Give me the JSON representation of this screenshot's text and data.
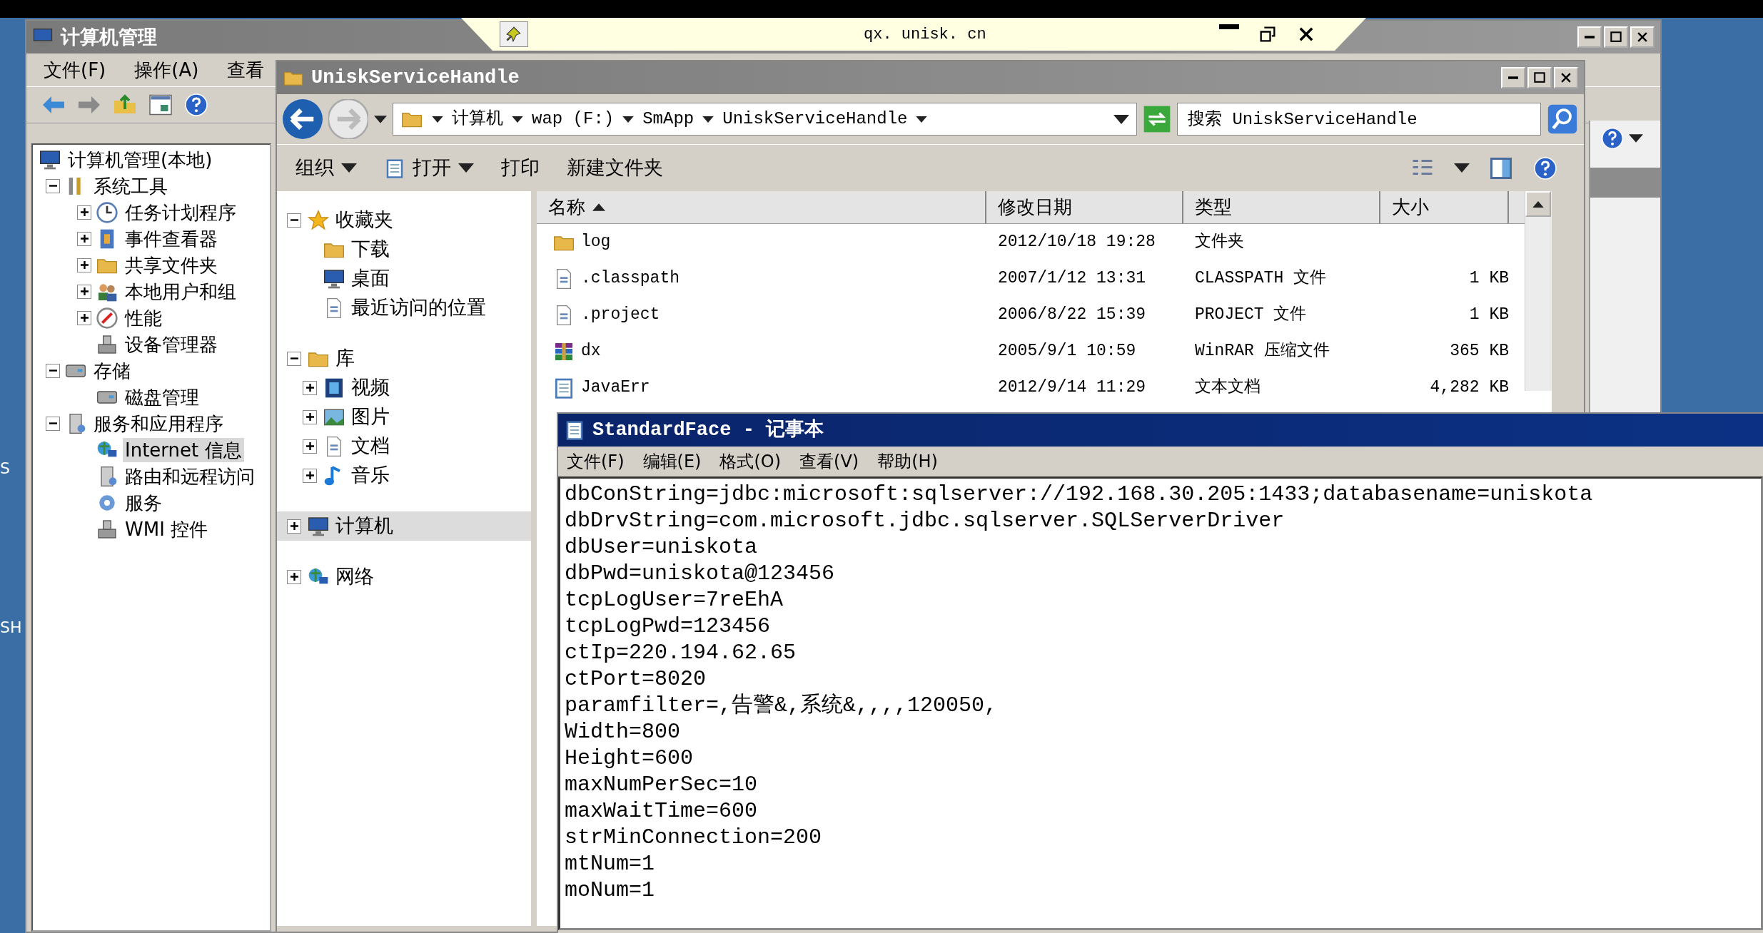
{
  "desktop_labels": [
    "S",
    "SH"
  ],
  "remote_bar": {
    "host": "qx. unisk. cn"
  },
  "mmc": {
    "title": "计算机管理",
    "menu": [
      "文件(F)",
      "操作(A)",
      "查看"
    ],
    "tree": [
      {
        "label": "计算机管理(本地)",
        "selected": false,
        "children": [
          {
            "label": "系统工具",
            "expanded": true,
            "selected": false,
            "children": [
              {
                "label": "任务计划程序",
                "expanded": false,
                "selected": false
              },
              {
                "label": "事件查看器",
                "expanded": false,
                "selected": false
              },
              {
                "label": "共享文件夹",
                "expanded": false,
                "selected": false
              },
              {
                "label": "本地用户和组",
                "expanded": false,
                "selected": false
              },
              {
                "label": "性能",
                "expanded": false,
                "selected": false
              },
              {
                "label": "设备管理器",
                "selected": false
              }
            ]
          },
          {
            "label": "存储",
            "expanded": true,
            "selected": false,
            "children": [
              {
                "label": "磁盘管理",
                "selected": false
              }
            ]
          },
          {
            "label": "服务和应用程序",
            "expanded": true,
            "selected": false,
            "children": [
              {
                "label": "Internet 信息",
                "selected": true
              },
              {
                "label": "路由和远程访问",
                "selected": false
              },
              {
                "label": "服务",
                "selected": false
              },
              {
                "label": "WMI 控件",
                "selected": false
              }
            ]
          }
        ]
      }
    ]
  },
  "explorer": {
    "title": "UniskServiceHandle",
    "breadcrumbs": [
      "计算机",
      "wap (F:)",
      "SmApp",
      "UniskServiceHandle"
    ],
    "search": {
      "placeholder": "搜索 UniskServiceHandle"
    },
    "commands": [
      {
        "label": "组织",
        "dropdown": true
      },
      {
        "label": "打开",
        "dropdown": true
      },
      {
        "label": "打印",
        "dropdown": false
      },
      {
        "label": "新建文件夹",
        "dropdown": false
      }
    ],
    "nav": [
      {
        "label": "收藏夹",
        "expanded": true,
        "selected": false,
        "children": [
          {
            "label": "下载"
          },
          {
            "label": "桌面"
          },
          {
            "label": "最近访问的位置"
          }
        ]
      },
      {
        "label": "库",
        "expanded": true,
        "selected": false,
        "children": [
          {
            "label": "视频",
            "expanded": false
          },
          {
            "label": "图片",
            "expanded": false
          },
          {
            "label": "文档",
            "expanded": false
          },
          {
            "label": "音乐",
            "expanded": false
          }
        ]
      },
      {
        "label": "计算机",
        "expanded": false,
        "selected": true
      },
      {
        "label": "网络",
        "expanded": false,
        "selected": false
      }
    ],
    "columns": [
      {
        "label": "名称",
        "sorted": true
      },
      {
        "label": "修改日期",
        "sorted": false
      },
      {
        "label": "类型",
        "sorted": false
      },
      {
        "label": "大小",
        "sorted": false
      }
    ],
    "files": [
      {
        "kind": "folder",
        "name": "log",
        "modified": "2012/10/18 19:28",
        "type": "文件夹"
      },
      {
        "kind": "file",
        "name": ".classpath",
        "modified": "2007/1/12 13:31",
        "type": "CLASSPATH 文件",
        "size": "1 KB"
      },
      {
        "kind": "file",
        "name": ".project",
        "modified": "2006/8/22 15:39",
        "type": "PROJECT 文件",
        "size": "1 KB"
      },
      {
        "kind": "archive",
        "name": "dx",
        "modified": "2005/9/1 10:59",
        "type": "WinRAR 压缩文件",
        "size": "365 KB"
      },
      {
        "kind": "text",
        "name": "JavaErr",
        "modified": "2012/9/14 11:29",
        "type": "文本文档",
        "size": "4,282 KB"
      }
    ]
  },
  "notepad": {
    "title": "StandardFace - 记事本",
    "menu": [
      "文件(F)",
      "编辑(E)",
      "格式(O)",
      "查看(V)",
      "帮助(H)"
    ],
    "lines": [
      "dbConString=jdbc:microsoft:sqlserver://192.168.30.205:1433;databasename=uniskota",
      "dbDrvString=com.microsoft.jdbc.sqlserver.SQLServerDriver",
      "dbUser=uniskota",
      "dbPwd=uniskota@123456",
      "tcpLogUser=7reEhA",
      "tcpLogPwd=123456",
      "ctIp=220.194.62.65",
      "ctPort=8020",
      "paramfilter=,告警&,系统&,,,,120050,",
      "Width=800",
      "Height=600",
      "maxNumPerSec=10",
      "maxWaitTime=600",
      "strMinConnection=200",
      "mtNum=1",
      "moNum=1"
    ]
  }
}
